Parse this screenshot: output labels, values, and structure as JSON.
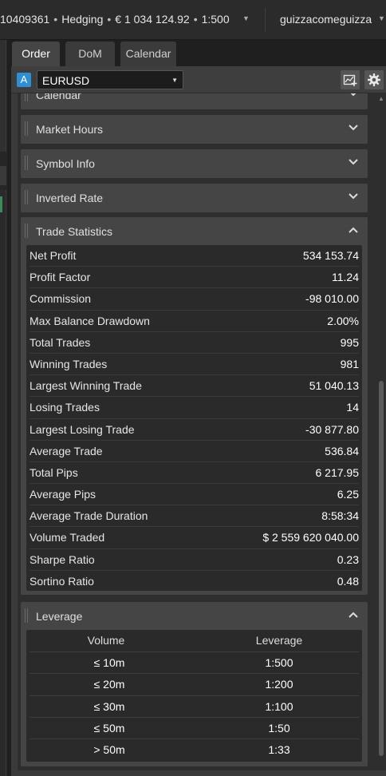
{
  "topbar": {
    "account_id": "10409361",
    "account_type": "Hedging",
    "balance": "€ 1 034 124.92",
    "leverage": "1:500",
    "separator": "•",
    "username": "guizzacomeguizza"
  },
  "tabs": [
    {
      "label": "Order",
      "active": true
    },
    {
      "label": "DoM",
      "active": false
    },
    {
      "label": "Calendar",
      "active": false
    }
  ],
  "symbol_bar": {
    "badge": "A",
    "symbol": "EURUSD"
  },
  "sections": {
    "calendar": {
      "title": "Calendar",
      "state": "collapsed"
    },
    "market_hours": {
      "title": "Market Hours",
      "state": "collapsed"
    },
    "symbol_info": {
      "title": "Symbol Info",
      "state": "collapsed"
    },
    "inverted_rate": {
      "title": "Inverted Rate",
      "state": "collapsed"
    },
    "trade_statistics": {
      "title": "Trade Statistics",
      "state": "expanded"
    },
    "leverage": {
      "title": "Leverage",
      "state": "expanded"
    }
  },
  "trade_statistics": [
    {
      "label": "Net Profit",
      "value": "534 153.74"
    },
    {
      "label": "Profit Factor",
      "value": "11.24"
    },
    {
      "label": "Commission",
      "value": "-98 010.00"
    },
    {
      "label": "Max Balance Drawdown",
      "value": "2.00%"
    },
    {
      "label": "Total Trades",
      "value": "995"
    },
    {
      "label": "Winning Trades",
      "value": "981"
    },
    {
      "label": "Largest Winning Trade",
      "value": "51 040.13"
    },
    {
      "label": "Losing Trades",
      "value": "14"
    },
    {
      "label": "Largest Losing Trade",
      "value": "-30 877.80"
    },
    {
      "label": "Average Trade",
      "value": "536.84"
    },
    {
      "label": "Total Pips",
      "value": "6 217.95"
    },
    {
      "label": "Average Pips",
      "value": "6.25"
    },
    {
      "label": "Average Trade Duration",
      "value": "8:58:34"
    },
    {
      "label": "Volume Traded",
      "value": "$ 2 559 620 040.00"
    },
    {
      "label": "Sharpe Ratio",
      "value": "0.23"
    },
    {
      "label": "Sortino Ratio",
      "value": "0.48"
    }
  ],
  "leverage_table": {
    "columns": [
      "Volume",
      "Leverage"
    ],
    "rows": [
      [
        "≤ 10m",
        "1:500"
      ],
      [
        "≤ 20m",
        "1:200"
      ],
      [
        "≤ 30m",
        "1:100"
      ],
      [
        "≤ 50m",
        "1:50"
      ],
      [
        "> 50m",
        "1:33"
      ]
    ]
  },
  "colors": {
    "accent": "#2f8fd6",
    "panel": "#3a3a3a",
    "row_bg": "#2a2a2a"
  },
  "icons": [
    "chevron-down-icon",
    "chevron-up-icon",
    "chart-add-icon",
    "gear-icon"
  ]
}
